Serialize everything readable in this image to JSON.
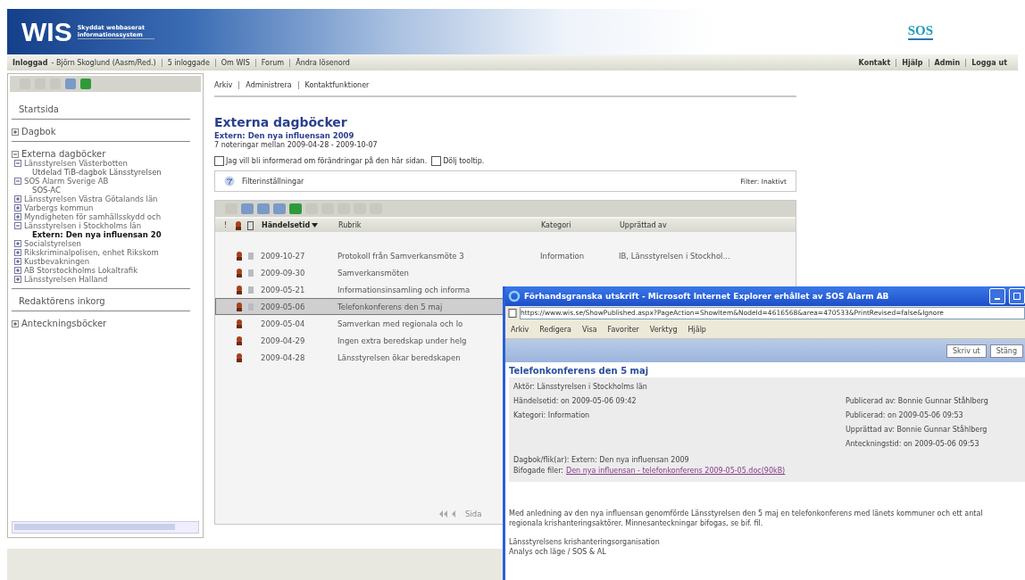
{
  "header": {
    "logo": "WIS",
    "tagline": "Skyddat webbaserat informationssystem",
    "partner_logo": "SOS"
  },
  "nav": {
    "status": "Inloggad",
    "user": "- Björn Skoglund (Aasm/Red.)",
    "links": [
      "5 inloggade",
      "Om WIS",
      "Forum",
      "Ändra lösenord"
    ],
    "right_links": [
      "Kontakt",
      "Hjälp",
      "Admin",
      "Logga ut"
    ]
  },
  "sidebar": {
    "sections": [
      {
        "label": "Startsida",
        "kind": "link"
      },
      {
        "label": "Dagbok",
        "kind": "folder",
        "expanded": false
      },
      {
        "label": "Externa dagböcker",
        "kind": "folder",
        "expanded": true,
        "children": [
          {
            "label": "Länsstyrelsen Västerbotten",
            "expanded": true,
            "children": [
              {
                "label": "Utdelad TiB-dagbok Länsstyrelsen",
                "selected": false
              }
            ]
          },
          {
            "label": "SOS Alarm Sverige AB",
            "expanded": true,
            "children": [
              {
                "label": "SOS-AC",
                "selected": false
              }
            ]
          },
          {
            "label": "Länsstyrelsen Västra Götalands län",
            "expanded": false
          },
          {
            "label": "Varbergs kommun",
            "expanded": false
          },
          {
            "label": "Myndigheten för samhällsskydd och",
            "expanded": false
          },
          {
            "label": "Länsstyrelsen i Stockholms län",
            "expanded": true,
            "children": [
              {
                "label": "Extern: Den nya influensan 20",
                "selected": true
              }
            ]
          },
          {
            "label": "Socialstyrelsen",
            "expanded": false
          },
          {
            "label": "Rikskriminalpolisen, enhet Rikskom",
            "expanded": false
          },
          {
            "label": "Kustbevakningen",
            "expanded": false
          },
          {
            "label": "AB Storstockholms Lokaltrafik",
            "expanded": false
          },
          {
            "label": "Länsstyrelsen Halland",
            "expanded": false
          }
        ]
      },
      {
        "label": "Redaktörens inkorg",
        "kind": "link"
      },
      {
        "label": "Anteckningsböcker",
        "kind": "folder",
        "expanded": false
      }
    ]
  },
  "main": {
    "breadcrumb": [
      "Arkiv",
      "Administrera",
      "Kontaktfunktioner"
    ],
    "title": "Externa dagböcker",
    "subtitle": "Extern: Den nya influensan 2009",
    "summary": "7 noteringar mellan 2009-04-28 - 2009-10-07",
    "options": [
      {
        "label": "Jag vill bli informerad om förändringar på den här sidan.",
        "checked": false
      },
      {
        "label": "Dölj tooltip.",
        "checked": false
      }
    ],
    "filter": {
      "label": "Filterinställningar",
      "status": "Filter: Inaktivt"
    },
    "table": {
      "columns": [
        {
          "label": "!",
          "kind": "text",
          "sorted": false
        },
        {
          "kind": "badge"
        },
        {
          "kind": "attachment"
        },
        {
          "label": "Händelsetid",
          "kind": "text",
          "sorted": true
        },
        {
          "label": "Rubrik",
          "kind": "text",
          "sorted": false
        },
        {
          "label": "Kategori",
          "kind": "text",
          "sorted": false
        },
        {
          "label": "Upprättad av",
          "kind": "text",
          "sorted": false
        }
      ],
      "rows": [
        {
          "date": "2009-10-27",
          "title": "Protokoll från Samverkansmöte 3",
          "category": "Information",
          "author": "IB, Länsstyrelsen i Stockhol...",
          "attachment": true,
          "selected": false
        },
        {
          "date": "2009-09-30",
          "title": "Samverkansmöten",
          "attachment": true,
          "selected": false
        },
        {
          "date": "2009-05-21",
          "title": "Informationsinsamling och informa",
          "attachment": true,
          "selected": false
        },
        {
          "date": "2009-05-06",
          "title": "Telefonkonferens den 5 maj",
          "attachment": true,
          "selected": true
        },
        {
          "date": "2009-05-04",
          "title": "Samverkan med regionala och lo",
          "attachment": false,
          "selected": false
        },
        {
          "date": "2009-04-29",
          "title": "Ingen extra beredskap under helg",
          "attachment": false,
          "selected": false
        },
        {
          "date": "2009-04-28",
          "title": "Länsstyrelsen ökar beredskapen",
          "attachment": false,
          "selected": false
        }
      ],
      "pager": "Sida"
    }
  },
  "popup": {
    "title": "Förhandsgranska utskrift - Microsoft Internet Explorer erhållet av SOS Alarm AB",
    "url": "https://www.wis.se/ShowPublished.aspx?PageAction=ShowItem&NodeId=4616568&area=470533&PrintRevised=false&Ignore",
    "menu": [
      "Arkiv",
      "Redigera",
      "Visa",
      "Favoriter",
      "Verktyg",
      "Hjälp"
    ],
    "buttons": [
      "Skriv ut",
      "Stäng"
    ],
    "heading": "Telefonkonferens den 5 maj",
    "left_fields": [
      "Aktör: Länsstyrelsen i Stockholms län",
      "Händelsetid: on 2009-05-06 09:42",
      "Kategori: Information"
    ],
    "right_fields": [
      "Publicerad av: Bonnie Gunnar Ståhlberg",
      "Publicerad: on 2009-05-06 09:53",
      "Upprättad av: Bonnie Gunnar Ståhlberg",
      "Anteckningstid: on 2009-05-06 09:53"
    ],
    "diary": "Dagbok/flik(ar): Extern: Den nya influensan 2009",
    "files_label": "Bifogade filer:",
    "file_link": "Den nya influensan - telefonkonferens 2009-05-05.doc(90kB)",
    "body": "Med anledning av den nya influensan genomförde Länsstyrelsen den 5 maj en telefonkonferens med länets kommuner och ett antal regionala krishanteringsaktörer. Minnesanteckningar bifogas, se bif. fil.",
    "signature": [
      "Länsstyrelsens krishanteringsorganisation",
      "Analys och läge / SOS & AL"
    ]
  }
}
